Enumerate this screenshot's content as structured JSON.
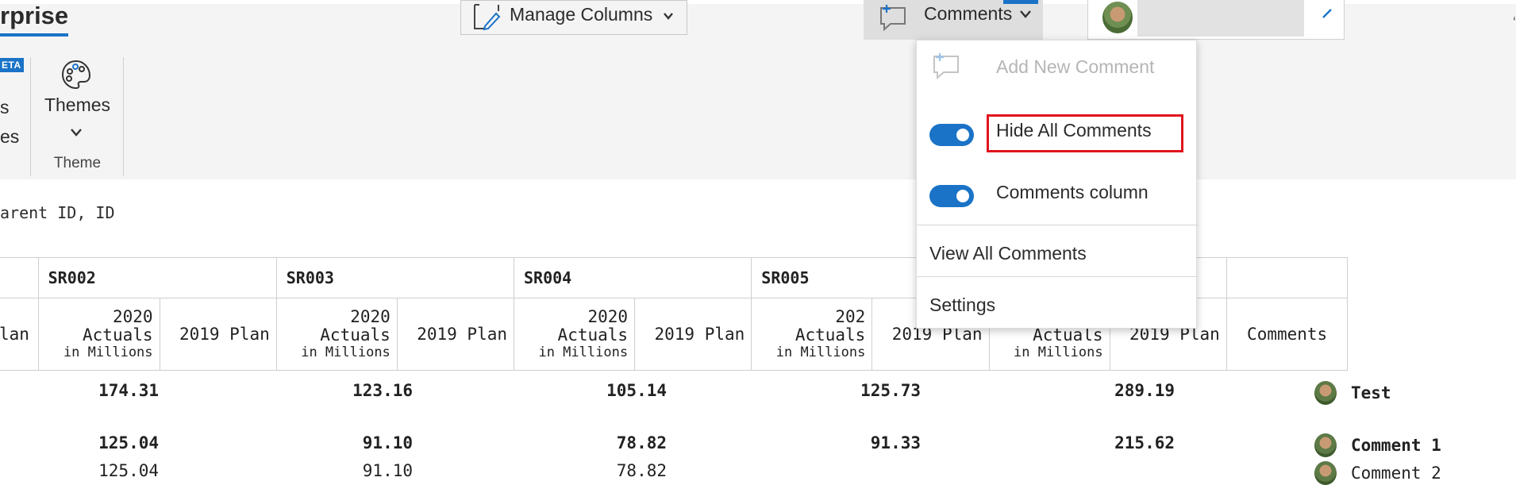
{
  "ribbon": {
    "app_title": "rprise",
    "beta_badge": "ETA",
    "cut_line_1": "s",
    "cut_line_2": "es",
    "themes_label": "Themes",
    "theme_group_label": "Theme",
    "manage_columns_label": "Manage Columns",
    "comments_label": "Comments"
  },
  "grid": {
    "parent_id_text": "arent ID, ID",
    "groups": [
      "",
      "SR002",
      "SR003",
      "SR004",
      "SR005",
      "",
      ""
    ],
    "columns": {
      "plan_cut": "lan",
      "actuals_line1": "2020",
      "actuals_line2": "Actuals",
      "actuals_unit": "in Millions",
      "plan": "2019 Plan",
      "sr005_year_cut": "202",
      "last_actuals_line2": "Actuals",
      "comments": "Comments"
    },
    "rows": [
      {
        "v1": "174.31",
        "v2": "123.16",
        "v3": "105.14",
        "v4": "125.73",
        "v5": "289.19",
        "comment": "Test"
      },
      {
        "v1": "125.04",
        "v2": "91.10",
        "v3": "78.82",
        "v4": "91.33",
        "v5": "215.62",
        "comment": "Comment 1"
      },
      {
        "v1": "125.04",
        "v2": "91.10",
        "v3": "78.82",
        "v4": "",
        "v5": "",
        "comment": "Comment 2"
      }
    ]
  },
  "comments_menu": {
    "add_new": "Add New Comment",
    "hide_all": "Hide All Comments",
    "hide_all_on": true,
    "comments_column": "Comments column",
    "comments_column_on": true,
    "view_all": "View All Comments",
    "settings": "Settings"
  },
  "colors": {
    "accent": "#1a73c7",
    "highlight": "#e0141e"
  }
}
